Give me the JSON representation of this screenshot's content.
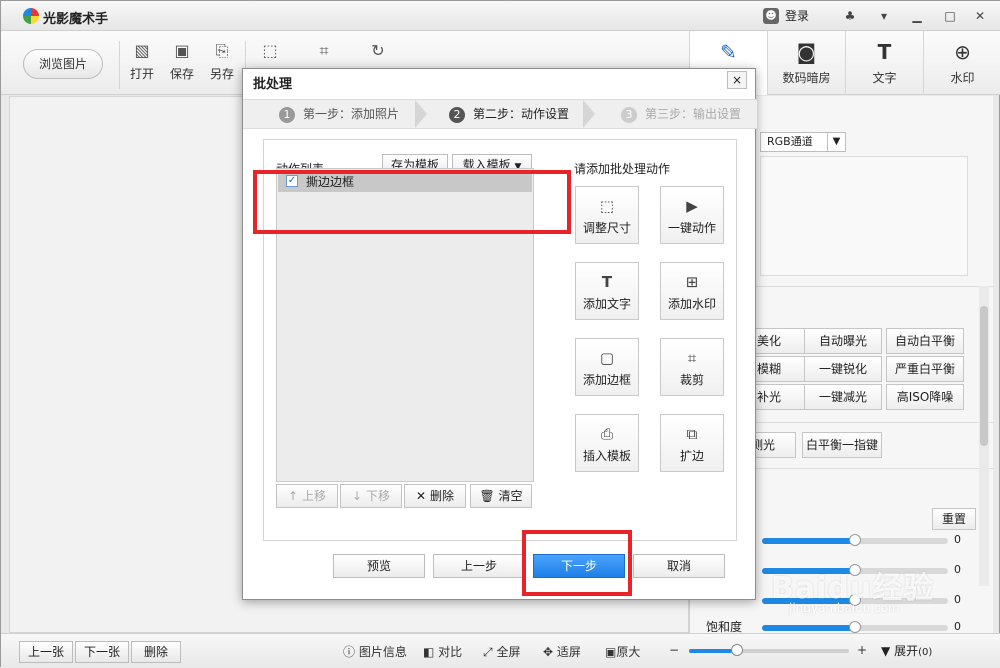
{
  "app": {
    "title": "光影魔术手",
    "login_label": "登录"
  },
  "toolbar": {
    "browse_label": "浏览图片",
    "open_label": "打开",
    "save_label": "保存",
    "saveas_label": "另存"
  },
  "right_tabs": [
    {
      "label": "",
      "icon": "edit-icon"
    },
    {
      "label": "数码暗房",
      "icon": "camera-icon"
    },
    {
      "label": "文字",
      "icon": "text-icon"
    },
    {
      "label": "水印",
      "icon": "watermark-icon"
    }
  ],
  "right_panel": {
    "channel": "RGB通道",
    "filter_buttons": [
      [
        "美化",
        "自动曝光",
        "自动白平衡"
      ],
      [
        "模糊",
        "一键锐化",
        "严重白平衡"
      ],
      [
        "补光",
        "一键减光",
        "高ISO降噪"
      ],
      [
        "测光",
        "白平衡一指键"
      ]
    ],
    "reset_label": "重置",
    "sliders": [
      {
        "label": "",
        "value": 0,
        "level": 0.5
      },
      {
        "label": "",
        "value": 0,
        "level": 0.5
      },
      {
        "label": "",
        "value": 0,
        "level": 0.5
      },
      {
        "label": "饱和度",
        "value": 0,
        "level": 0.5
      }
    ]
  },
  "bottom": {
    "prev_label": "上一张",
    "next_label": "下一张",
    "delete_label": "删除",
    "info_label": "图片信息",
    "compare_label": "对比",
    "fullscreen_label": "全屏",
    "fit_label": "适屏",
    "original_label": "原大",
    "expand_label": "展开",
    "expand_count": "(0)",
    "zoom_level": 0.3
  },
  "dialog": {
    "title": "批处理",
    "close_label": "×",
    "steps": [
      {
        "num": "1",
        "label": "第一步：添加照片"
      },
      {
        "num": "2",
        "label": "第二步：动作设置"
      },
      {
        "num": "3",
        "label": "第三步：输出设置"
      }
    ],
    "action_list_label": "动作列表",
    "save_template_label": "存为模板",
    "load_template_label": "载入模板",
    "add_actions_label": "请添加批处理动作",
    "list_items": [
      "撕边边框"
    ],
    "actions": [
      {
        "label": "调整尺寸",
        "icon": "resize-icon"
      },
      {
        "label": "一键动作",
        "icon": "play-icon"
      },
      {
        "label": "添加文字",
        "icon": "text-icon"
      },
      {
        "label": "添加水印",
        "icon": "watermark-icon"
      },
      {
        "label": "添加边框",
        "icon": "frame-icon"
      },
      {
        "label": "裁剪",
        "icon": "crop-icon"
      },
      {
        "label": "插入模板",
        "icon": "template-icon"
      },
      {
        "label": "扩边",
        "icon": "expand-icon"
      }
    ],
    "move_up_label": "上移",
    "move_down_label": "下移",
    "delete_label": "删除",
    "clear_label": "清空",
    "preview_label": "预览",
    "prev_label": "上一步",
    "next_label": "下一步",
    "cancel_label": "取消"
  },
  "watermark": {
    "text": "Baidu经验",
    "url": "jingyan.baidu.com"
  },
  "colors": {
    "accent": "#1e7fe6",
    "highlight": "#e8232a"
  }
}
